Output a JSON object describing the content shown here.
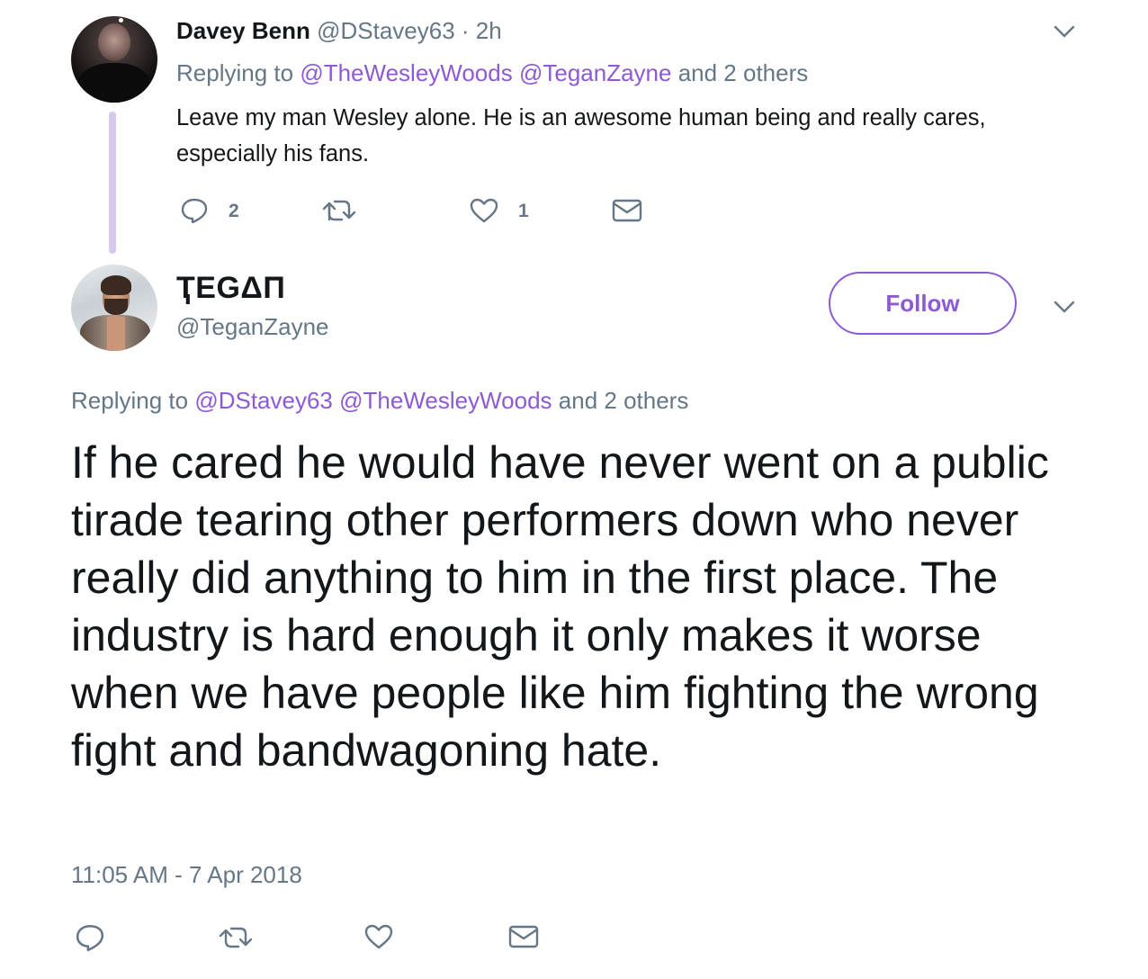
{
  "reply_tweet": {
    "author_name": "Davey Benn",
    "author_handle": "@DStavey63",
    "separator": "·",
    "time": "2h",
    "replying_prefix": "Replying to",
    "mentions": [
      "@TheWesleyWoods",
      "@TeganZayne"
    ],
    "replying_suffix": "and 2 others",
    "text": "Leave my man Wesley alone. He is an awesome human being and really cares, especially his fans.",
    "reply_count": "2",
    "like_count": "1",
    "icons": {
      "reply": "reply-icon",
      "retweet": "retweet-icon",
      "like": "heart-icon",
      "dm": "envelope-icon",
      "menu": "chevron-down-icon"
    }
  },
  "main_tweet": {
    "author_name": "ҬEGΔП",
    "author_handle": "@TeganZayne",
    "follow_label": "Follow",
    "replying_prefix": "Replying to",
    "mentions": [
      "@DStavey63",
      "@TheWesleyWoods"
    ],
    "replying_suffix": "and 2 others",
    "text": "If he cared he would have never went on a public tirade tearing other performers down who never really did anything to him in the first place. The industry is hard enough it only makes it worse when we have people like him fighting the wrong fight and bandwagoning hate.",
    "timestamp": "11:05 AM - 7 Apr 2018",
    "icons": {
      "reply": "reply-icon",
      "retweet": "retweet-icon",
      "like": "heart-icon",
      "dm": "envelope-icon",
      "menu": "chevron-down-icon"
    }
  },
  "colors": {
    "accent": "#8e5ad4",
    "muted_text": "#657786",
    "body_text": "#14171a",
    "thread_line": "#d6c9ef",
    "icon": "#657786"
  }
}
